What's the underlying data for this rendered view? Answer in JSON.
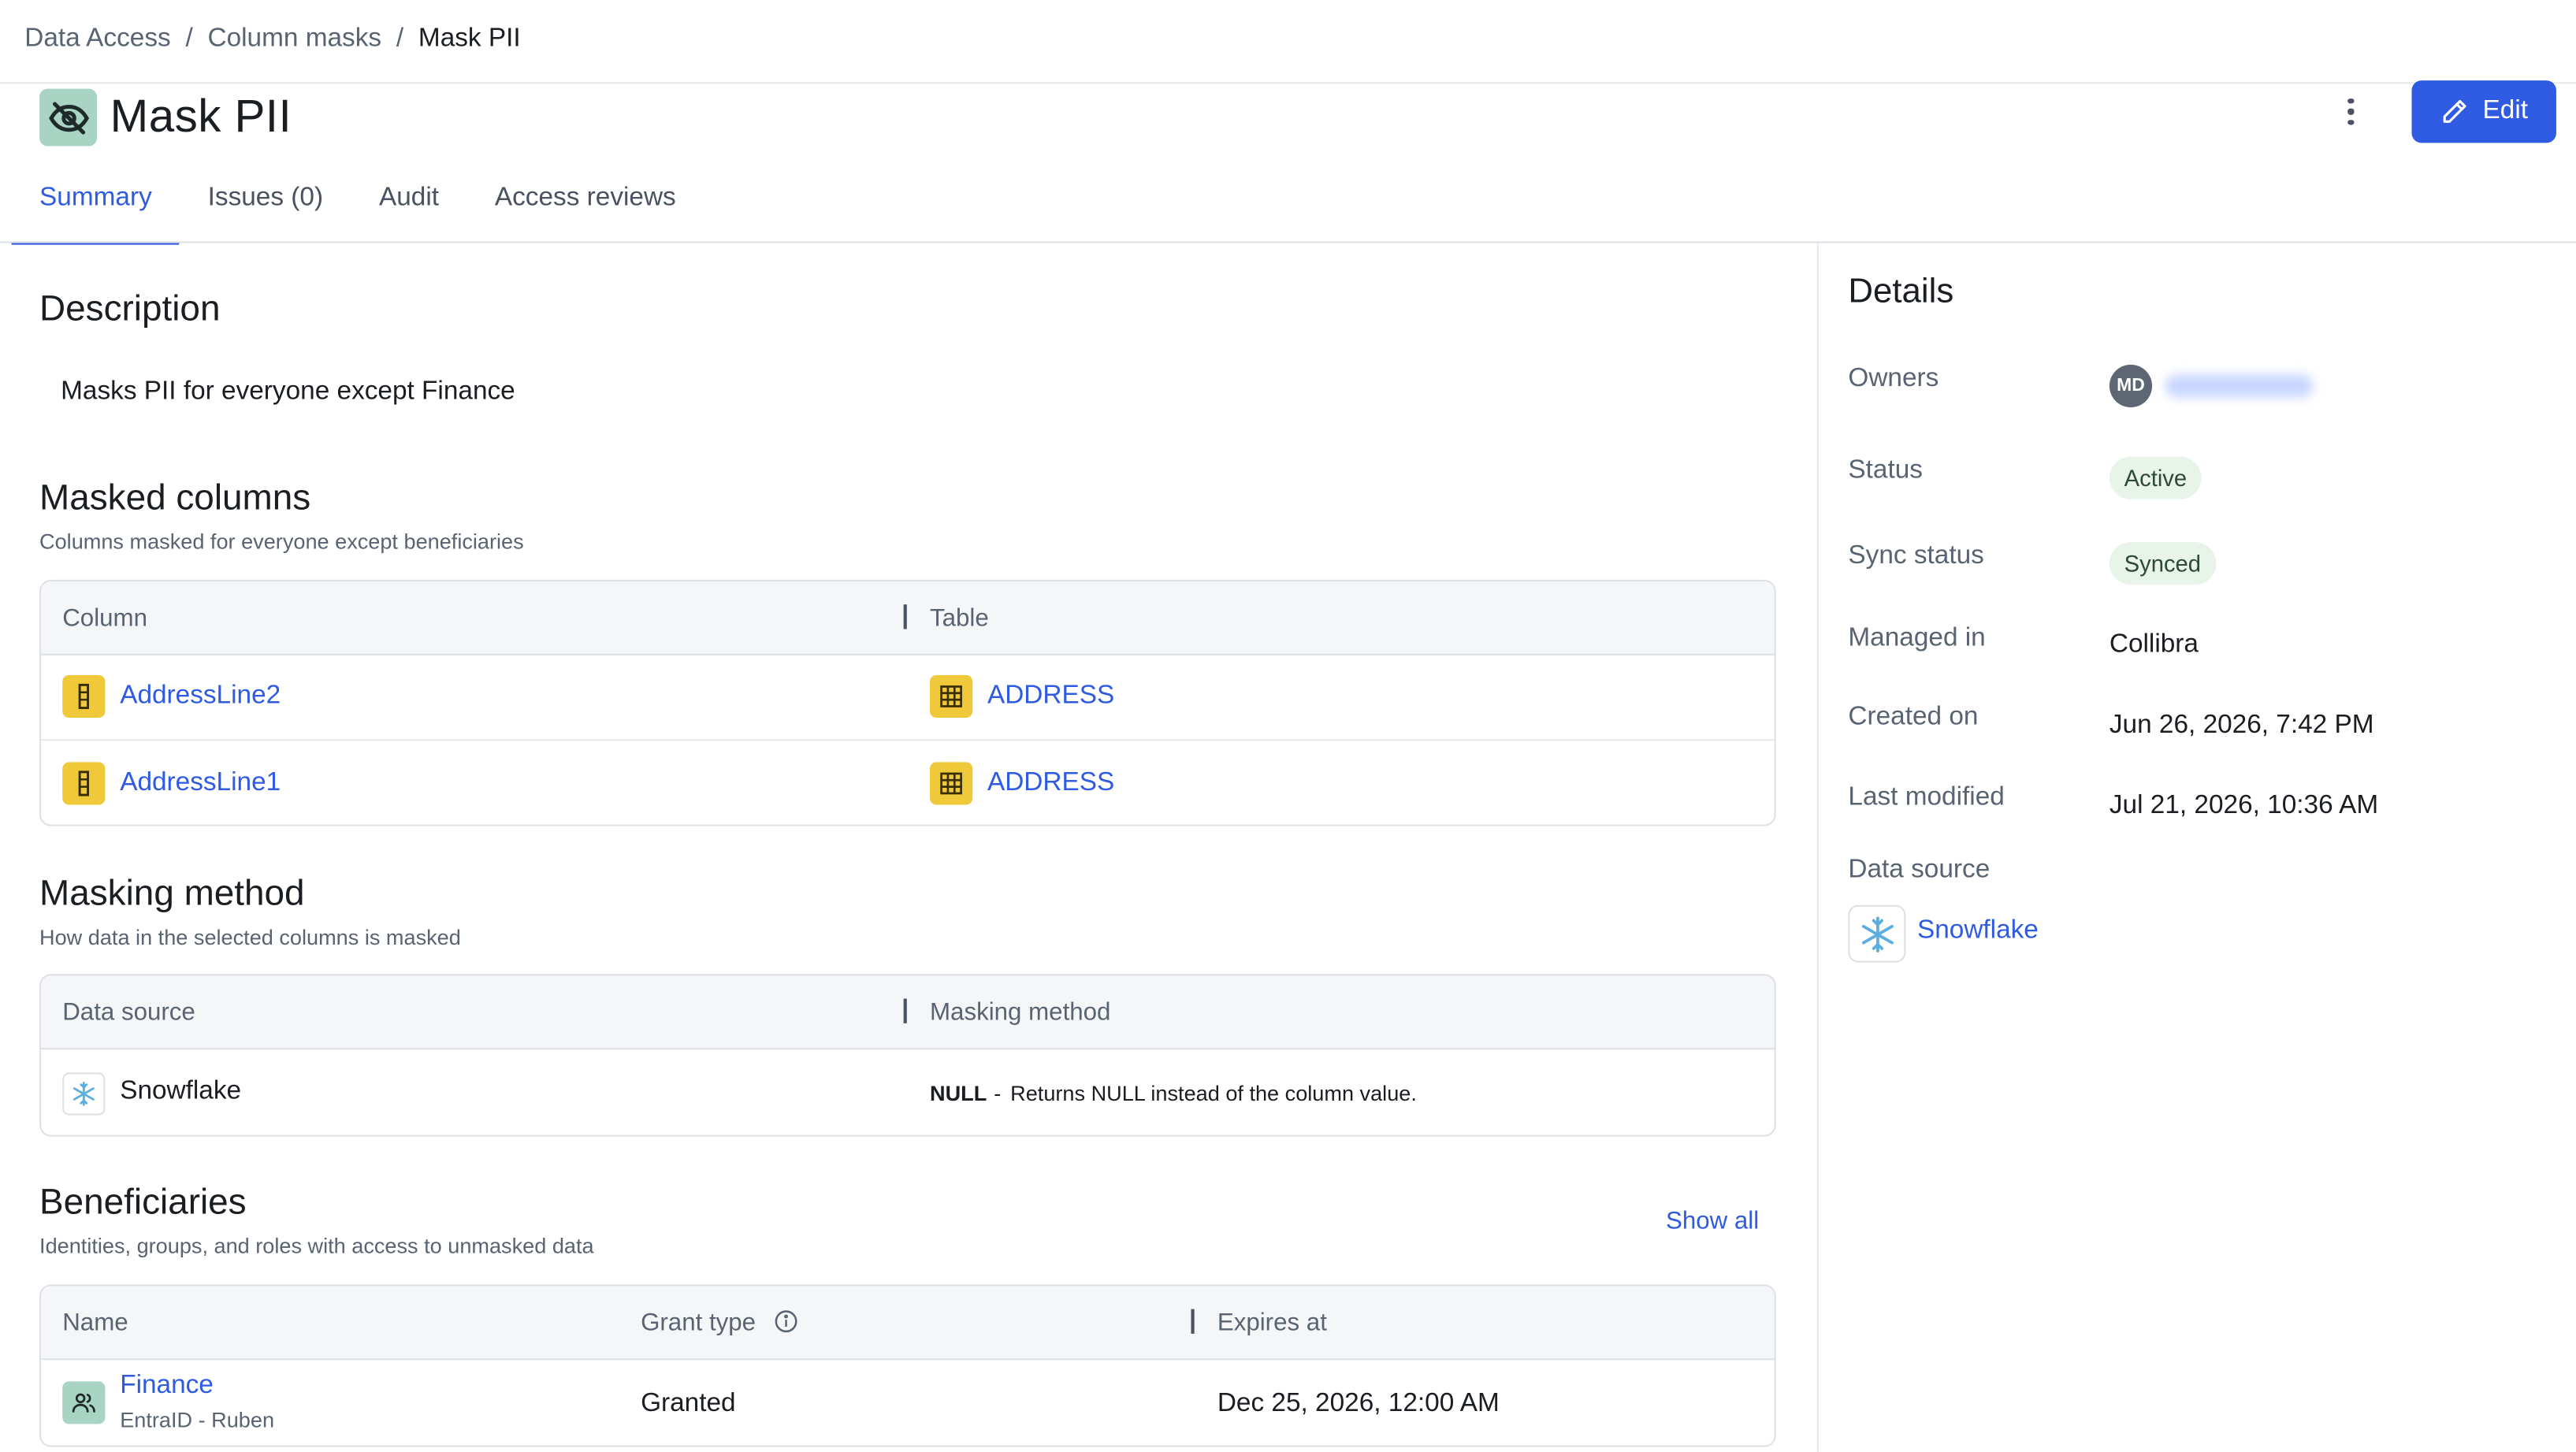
{
  "breadcrumb": {
    "items": [
      "Data Access",
      "Column masks"
    ],
    "separator": "/",
    "current": "Mask PII"
  },
  "header": {
    "title": "Mask PII",
    "edit_label": "Edit"
  },
  "tabs": [
    {
      "label": "Summary",
      "active": true
    },
    {
      "label": "Issues (0)",
      "active": false
    },
    {
      "label": "Audit",
      "active": false
    },
    {
      "label": "Access reviews",
      "active": false
    }
  ],
  "description": {
    "heading": "Description",
    "text": "Masks PII for everyone except Finance"
  },
  "masked_columns": {
    "heading": "Masked columns",
    "subtitle": "Columns masked for everyone except beneficiaries",
    "columns": [
      "Column",
      "Table"
    ],
    "rows": [
      {
        "column": "AddressLine2",
        "table": "ADDRESS"
      },
      {
        "column": "AddressLine1",
        "table": "ADDRESS"
      }
    ]
  },
  "masking_method": {
    "heading": "Masking method",
    "subtitle": "How data in the selected columns is masked",
    "columns": [
      "Data source",
      "Masking method"
    ],
    "rows": [
      {
        "source": "Snowflake",
        "method": "NULL",
        "method_sep": "-",
        "method_desc": "Returns NULL instead of the column value."
      }
    ]
  },
  "beneficiaries": {
    "heading": "Beneficiaries",
    "subtitle": "Identities, groups, and roles with access to unmasked data",
    "show_all": "Show all",
    "columns": [
      "Name",
      "Grant type",
      "Expires at"
    ],
    "rows": [
      {
        "name": "Finance",
        "meta": "EntraID - Ruben",
        "grant": "Granted",
        "expires": "Dec 25, 2026, 12:00 AM"
      }
    ]
  },
  "details": {
    "heading": "Details",
    "owners_label": "Owners",
    "owner_initials": "MD",
    "status_label": "Status",
    "status": "Active",
    "sync_label": "Sync status",
    "sync": "Synced",
    "managed_label": "Managed in",
    "managed": "Collibra",
    "created_label": "Created on",
    "created": "Jun 26, 2026, 7:42 PM",
    "modified_label": "Last modified",
    "modified": "Jul 21, 2026, 10:36 AM",
    "source_label": "Data source",
    "source": "Snowflake"
  },
  "colors": {
    "accent": "#2f5be3",
    "status_bg": "#e8f3ea",
    "icon_yellow": "#f0c93a",
    "icon_teal": "#a9d4c4",
    "snowflake": "#5aaee0"
  },
  "icons": [
    "eye-off-icon",
    "kebab-menu-icon",
    "pencil-icon",
    "column-icon",
    "table-icon",
    "snowflake-icon",
    "info-icon",
    "group-icon"
  ]
}
